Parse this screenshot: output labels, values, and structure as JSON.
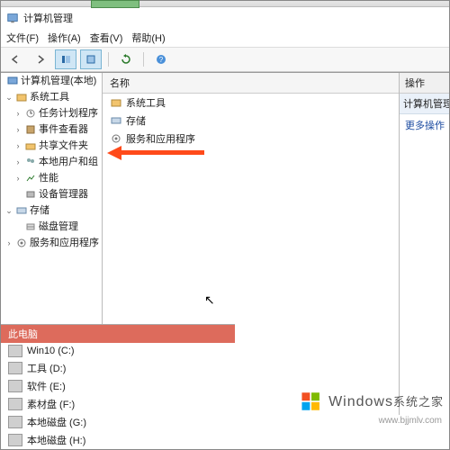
{
  "window": {
    "title": "计算机管理"
  },
  "menu": {
    "file": "文件(F)",
    "action": "操作(A)",
    "view": "查看(V)",
    "help": "帮助(H)"
  },
  "tree": {
    "header": "计算机管理(本地)",
    "root": "计算机管理(本地)",
    "systools": "系统工具",
    "scheduler": "任务计划程序",
    "eventviewer": "事件查看器",
    "shared": "共享文件夹",
    "localusers": "本地用户和组",
    "perf": "性能",
    "devicemgr": "设备管理器",
    "storage": "存储",
    "diskmgmt": "磁盘管理",
    "services": "服务和应用程序"
  },
  "mid": {
    "header": "名称",
    "item1": "系统工具",
    "item2": "存储",
    "item3": "服务和应用程序"
  },
  "right": {
    "header": "操作",
    "sub": "计算机管理(本地)",
    "more": "更多操作"
  },
  "drives": {
    "header": "此电脑",
    "d0": "Win10 (C:)",
    "d1": "工具 (D:)",
    "d2": "软件 (E:)",
    "d3": "素材盘 (F:)",
    "d4": "本地磁盘 (G:)",
    "d5": "本地磁盘 (H:)"
  },
  "wm": {
    "brand": "Windows",
    "sub": "系统之家",
    "url": "www.bjjmlv.com"
  }
}
